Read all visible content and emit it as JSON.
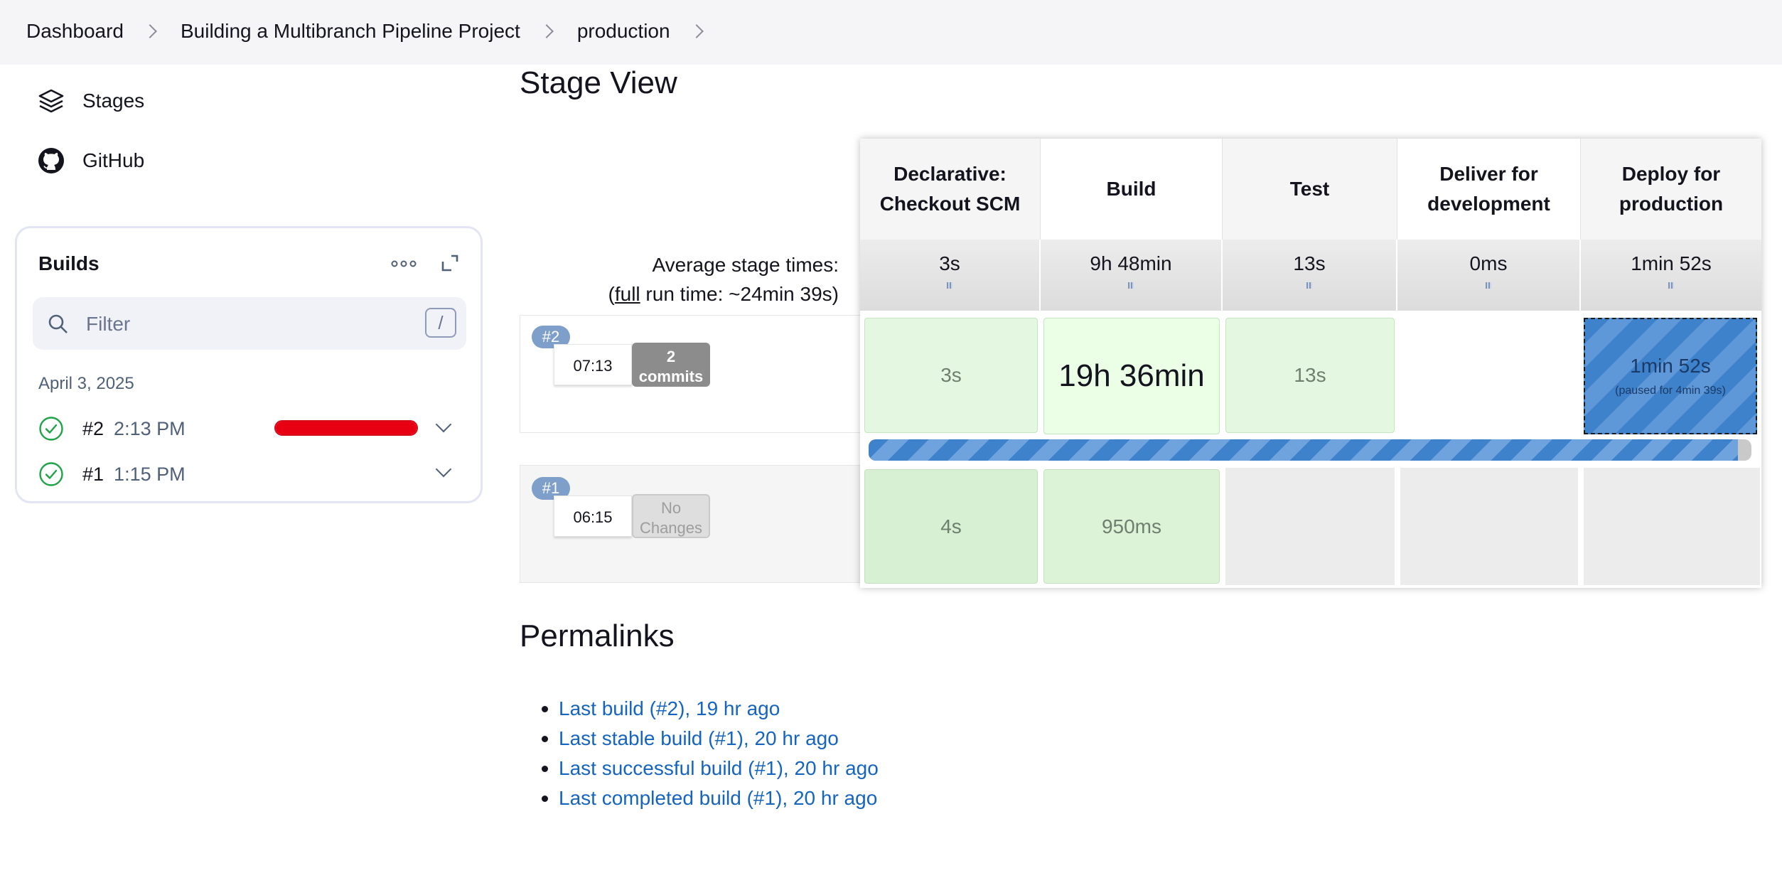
{
  "breadcrumb": [
    "Dashboard",
    "Building a Multibranch Pipeline Project",
    "production"
  ],
  "sidebar": {
    "links": [
      {
        "label": "Stages",
        "icon": "stages-icon"
      },
      {
        "label": "GitHub",
        "icon": "github-icon"
      }
    ]
  },
  "builds": {
    "title": "Builds",
    "filter_placeholder": "Filter",
    "filter_shortcut": "/",
    "date": "April 3, 2025",
    "items": [
      {
        "number": "#2",
        "time": "2:13 PM",
        "status": "success",
        "progress": 1.0,
        "progress_color": "#e60012"
      },
      {
        "number": "#1",
        "time": "1:15 PM",
        "status": "success"
      }
    ]
  },
  "stage_view": {
    "title": "Stage View",
    "avg_label": "Average stage times:",
    "run_time_prefix": "(",
    "run_time_link": "full",
    "run_time_suffix": " run time: ~24min 39s)",
    "stages": [
      {
        "name_line1": "Declarative:",
        "name_line2": "Checkout SCM",
        "avg": "3s"
      },
      {
        "name_line1": "Build",
        "name_line2": "",
        "avg": "9h 48min"
      },
      {
        "name_line1": "Test",
        "name_line2": "",
        "avg": "13s"
      },
      {
        "name_line1": "Deliver for",
        "name_line2": "development",
        "avg": "0ms"
      },
      {
        "name_line1": "Deploy for",
        "name_line2": "production",
        "avg": "1min 52s"
      }
    ],
    "runs": [
      {
        "badge": "#2",
        "time": "07:13",
        "changes_line1": "2",
        "changes_line2": "commits",
        "cells": [
          "3s",
          "19h 36min",
          "13s",
          "",
          "1min 52s"
        ],
        "paused_note": "(paused for 4min 39s)",
        "progress": 0.985
      },
      {
        "badge": "#1",
        "time": "06:15",
        "changes_line1": "No",
        "changes_line2": "Changes",
        "cells": [
          "4s",
          "950ms",
          "",
          "",
          ""
        ]
      }
    ]
  },
  "permalinks": {
    "title": "Permalinks",
    "items": [
      "Last build (#2), 19 hr ago",
      "Last stable build (#1), 20 hr ago",
      "Last successful build (#1), 20 hr ago",
      "Last completed build (#1), 20 hr ago"
    ]
  },
  "colors": {
    "success_cell": "#e4f8e1",
    "paused_cell": "#3f82cc",
    "link": "#1565c0",
    "build_badge": "#7d9fca"
  }
}
